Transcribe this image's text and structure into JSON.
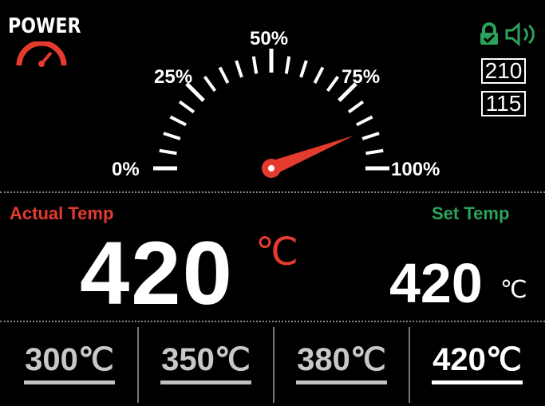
{
  "header": {
    "power_label": "POWER",
    "icons": {
      "power_gauge": "speedometer-icon",
      "lock": "lock-icon",
      "speaker": "speaker-icon"
    },
    "colors": {
      "accent_red": "#e53b2f",
      "accent_green": "#2ca25b"
    },
    "box_top": "210",
    "box_bottom": "115"
  },
  "gauge": {
    "labels": {
      "p0": "0%",
      "p25": "25%",
      "p50": "50%",
      "p75": "75%",
      "p100": "100%"
    },
    "power_percent": 88
  },
  "actual": {
    "label": "Actual Temp",
    "value": "420",
    "unit": "℃"
  },
  "set": {
    "label": "Set Temp",
    "value": "420",
    "unit": "℃"
  },
  "presets": [
    {
      "value": "300℃",
      "active": false
    },
    {
      "value": "350℃",
      "active": false
    },
    {
      "value": "380℃",
      "active": false
    },
    {
      "value": "420℃",
      "active": true
    }
  ]
}
